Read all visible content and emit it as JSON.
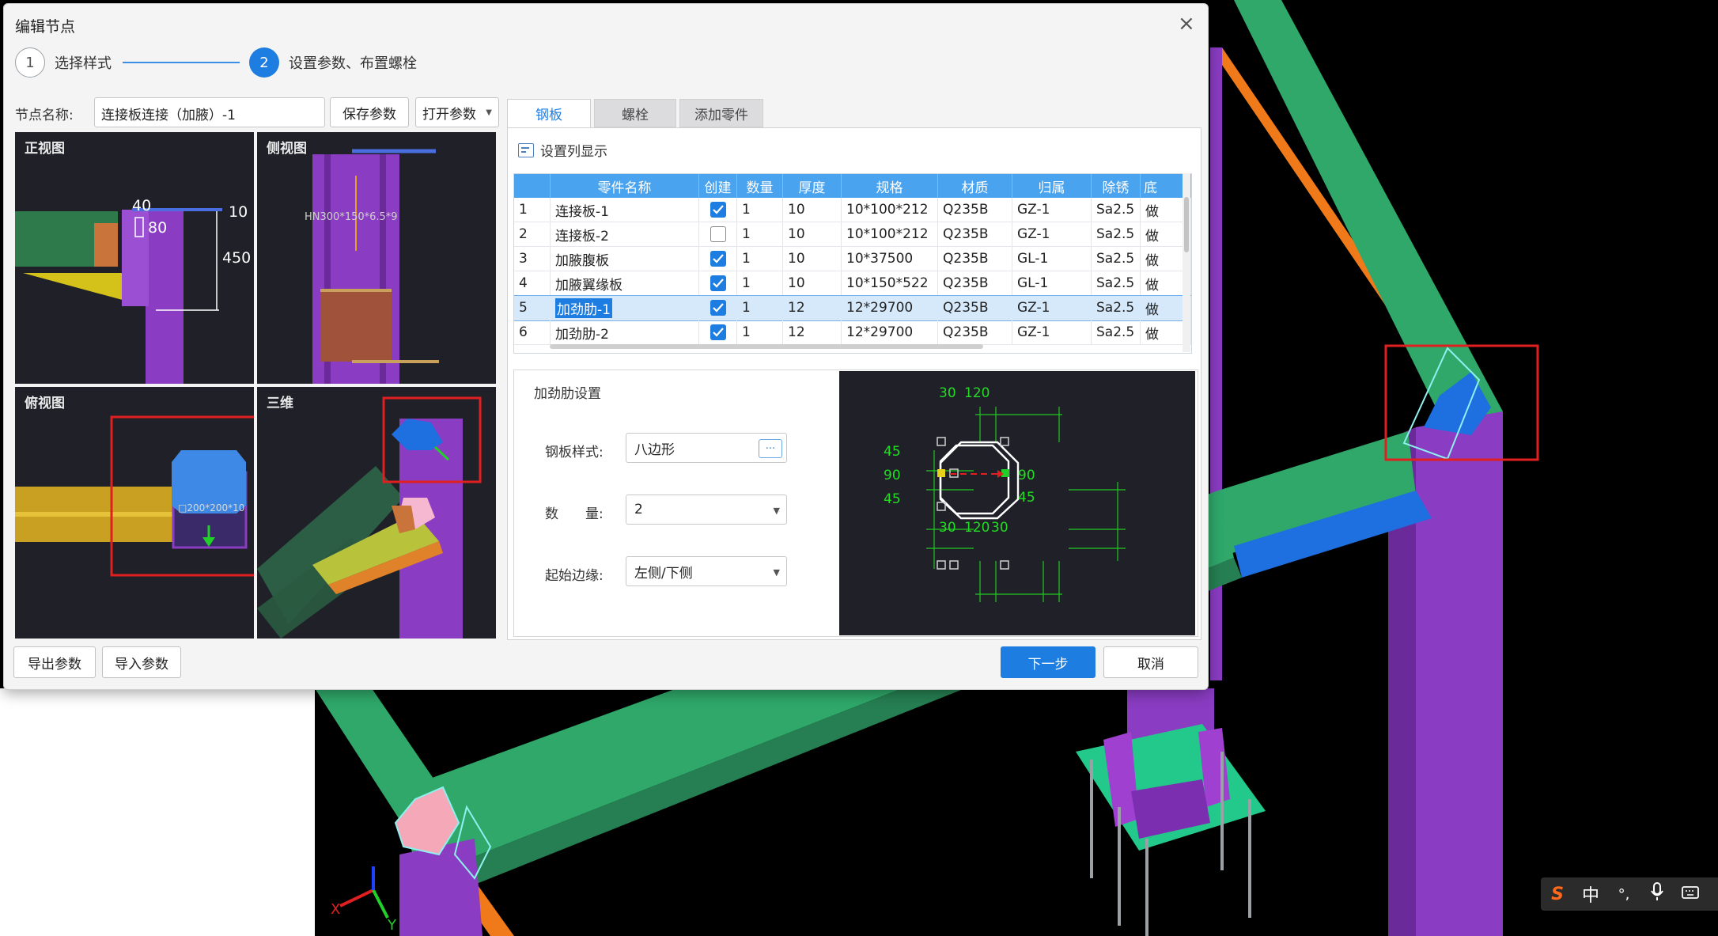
{
  "dialog": {
    "title": "编辑节点",
    "close_glyph": "×",
    "steps": [
      {
        "number": "1",
        "label": "选择样式"
      },
      {
        "number": "2",
        "label": "设置参数、布置螺栓"
      }
    ],
    "node_name_label": "节点名称:",
    "node_name_value": "连接板连接（加腋）-1",
    "save_params": "保存参数",
    "open_params": "打开参数",
    "export_params": "导出参数",
    "import_params": "导入参数",
    "next_button": "下一步",
    "cancel_button": "取消"
  },
  "views": {
    "front": {
      "label": "正视图",
      "dims": [
        "40",
        "10",
        "80",
        "450"
      ]
    },
    "side": {
      "label": "侧视图",
      "section_text": "HN300*150*6.5*9"
    },
    "top": {
      "label": "俯视图",
      "section_text": "□200*200*10"
    },
    "three_d": {
      "label": "三维"
    }
  },
  "tabs": [
    {
      "label": "钢板",
      "active": true
    },
    {
      "label": "螺栓",
      "active": false
    },
    {
      "label": "添加零件",
      "active": false
    }
  ],
  "column_settings_label": "设置列显示",
  "table": {
    "headers": [
      "",
      "零件名称",
      "创建",
      "数量",
      "厚度",
      "规格",
      "材质",
      "归属",
      "除锈",
      "底"
    ],
    "rows": [
      {
        "idx": "1",
        "name": "连接板-1",
        "create": true,
        "qty": "1",
        "thk": "10",
        "spec": "10*100*212",
        "mat": "Q235B",
        "owner": "GZ-1",
        "rust": "Sa2.5",
        "base": "做",
        "selected": false
      },
      {
        "idx": "2",
        "name": "连接板-2",
        "create": false,
        "qty": "1",
        "thk": "10",
        "spec": "10*100*212",
        "mat": "Q235B",
        "owner": "GZ-1",
        "rust": "Sa2.5",
        "base": "做",
        "selected": false
      },
      {
        "idx": "3",
        "name": "加腋腹板",
        "create": true,
        "qty": "1",
        "thk": "10",
        "spec": "10*37500",
        "mat": "Q235B",
        "owner": "GL-1",
        "rust": "Sa2.5",
        "base": "做",
        "selected": false
      },
      {
        "idx": "4",
        "name": "加腋翼缘板",
        "create": true,
        "qty": "1",
        "thk": "10",
        "spec": "10*150*522",
        "mat": "Q235B",
        "owner": "GL-1",
        "rust": "Sa2.5",
        "base": "做",
        "selected": false
      },
      {
        "idx": "5",
        "name": "加劲肋-1",
        "create": true,
        "qty": "1",
        "thk": "12",
        "spec": "12*29700",
        "mat": "Q235B",
        "owner": "GZ-1",
        "rust": "Sa2.5",
        "base": "做",
        "selected": true
      },
      {
        "idx": "6",
        "name": "加劲肋-2",
        "create": true,
        "qty": "1",
        "thk": "12",
        "spec": "12*29700",
        "mat": "Q235B",
        "owner": "GZ-1",
        "rust": "Sa2.5",
        "base": "做",
        "selected": false
      }
    ]
  },
  "stiffener": {
    "title": "加劲肋设置",
    "plate_style_label": "钢板样式:",
    "plate_style_value": "八边形",
    "quantity_label": "数　　量:",
    "quantity_value": "2",
    "start_edge_label": "起始边缘:",
    "start_edge_value": "左侧/下侧",
    "preview_dims": {
      "top_a": "30",
      "top_b": "120",
      "left_a": "45",
      "left_b": "90",
      "left_c": "45",
      "right_a": "90",
      "right_b": "45",
      "bot_a": "30",
      "bot_b": "120",
      "bot_c": "30"
    }
  },
  "ime": {
    "logo": "S",
    "mode": "中",
    "punct": "°,",
    "mic": "mic-icon",
    "keyboard": "keyboard-icon"
  },
  "colors": {
    "accent": "#1e7de0",
    "header": "#4aa3ee",
    "dim_green": "#22dd22",
    "member_purple": "#8a3cc2",
    "member_green": "#2fa86a"
  }
}
